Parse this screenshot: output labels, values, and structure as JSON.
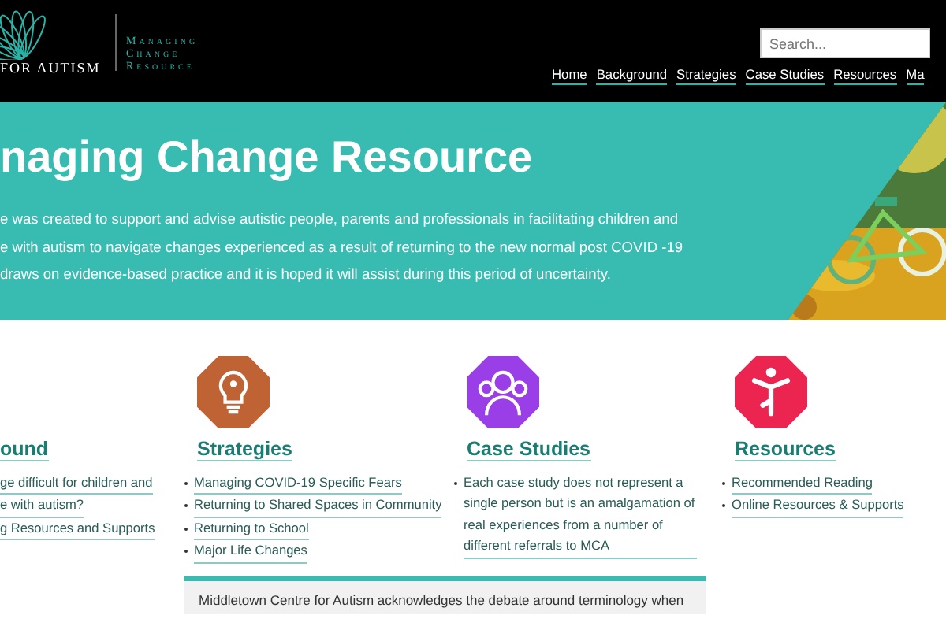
{
  "header": {
    "logo_text": "FOR AUTISM",
    "site_title": [
      "Managing",
      "Change",
      "Resource"
    ],
    "search": {
      "placeholder": "Search..."
    },
    "nav": [
      {
        "label": "Home"
      },
      {
        "label": "Background"
      },
      {
        "label": "Strategies"
      },
      {
        "label": "Case Studies"
      },
      {
        "label": "Resources"
      },
      {
        "label": "Ma"
      }
    ]
  },
  "hero": {
    "title": "naging Change Resource",
    "lines": [
      "e was created to support and advise autistic people, parents and professionals in facilitating children and",
      "e with autism to navigate changes experienced as a result of returning to the new normal post COVID -19",
      "draws on evidence-based practice and it is hoped it will assist during this period of uncertainty."
    ],
    "image": {
      "kind": "picture"
    }
  },
  "columns": [
    {
      "heading": "ound",
      "bullets": false,
      "items": [
        "ge difficult for children and",
        "e with autism?",
        "g Resources and Supports"
      ]
    },
    {
      "heading": "Strategies",
      "color": "#bf6234",
      "bullets": true,
      "items": [
        "Managing COVID-19 Specific Fears",
        "Returning to Shared Spaces in Community",
        "Returning to School",
        "Major Life Changes"
      ]
    },
    {
      "heading": "Case Studies",
      "color": "#9a3ee8",
      "bullets": true,
      "items": [
        "Each case study does not represent a single person but is an amalgamation of real experiences from a number of different referrals to MCA"
      ]
    },
    {
      "heading": "Resources",
      "color": "#ec2450",
      "bullets": true,
      "items": [
        "Recommended Reading",
        "Online Resources & Supports"
      ]
    }
  ],
  "notice": {
    "text": "Middletown Centre for Autism acknowledges the debate around terminology when"
  }
}
